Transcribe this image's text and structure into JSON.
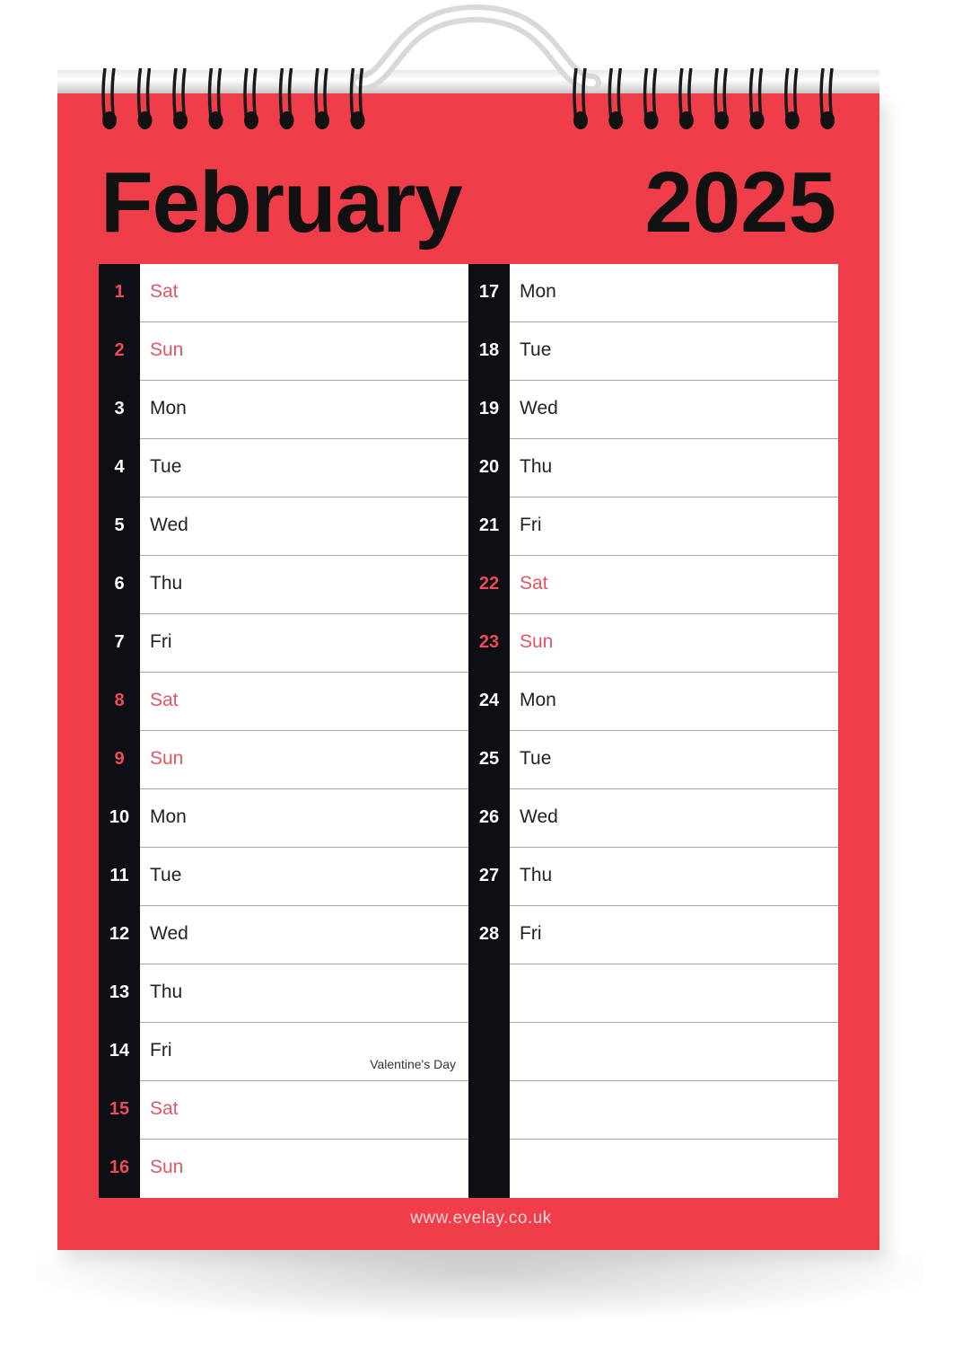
{
  "calendar": {
    "month": "February",
    "year": "2025",
    "website": "www.evelay.co.uk",
    "colors": {
      "page": "#ef3d4a",
      "strip": "#0d0f14",
      "weekend_text": "#e25662"
    },
    "left_column": [
      {
        "num": "1",
        "day": "Sat",
        "weekend": true,
        "note": ""
      },
      {
        "num": "2",
        "day": "Sun",
        "weekend": true,
        "note": ""
      },
      {
        "num": "3",
        "day": "Mon",
        "weekend": false,
        "note": ""
      },
      {
        "num": "4",
        "day": "Tue",
        "weekend": false,
        "note": ""
      },
      {
        "num": "5",
        "day": "Wed",
        "weekend": false,
        "note": ""
      },
      {
        "num": "6",
        "day": "Thu",
        "weekend": false,
        "note": ""
      },
      {
        "num": "7",
        "day": "Fri",
        "weekend": false,
        "note": ""
      },
      {
        "num": "8",
        "day": "Sat",
        "weekend": true,
        "note": ""
      },
      {
        "num": "9",
        "day": "Sun",
        "weekend": true,
        "note": ""
      },
      {
        "num": "10",
        "day": "Mon",
        "weekend": false,
        "note": ""
      },
      {
        "num": "11",
        "day": "Tue",
        "weekend": false,
        "note": ""
      },
      {
        "num": "12",
        "day": "Wed",
        "weekend": false,
        "note": ""
      },
      {
        "num": "13",
        "day": "Thu",
        "weekend": false,
        "note": ""
      },
      {
        "num": "14",
        "day": "Fri",
        "weekend": false,
        "note": "Valentine's Day"
      },
      {
        "num": "15",
        "day": "Sat",
        "weekend": true,
        "note": ""
      },
      {
        "num": "16",
        "day": "Sun",
        "weekend": true,
        "note": ""
      }
    ],
    "right_column": [
      {
        "num": "17",
        "day": "Mon",
        "weekend": false,
        "note": ""
      },
      {
        "num": "18",
        "day": "Tue",
        "weekend": false,
        "note": ""
      },
      {
        "num": "19",
        "day": "Wed",
        "weekend": false,
        "note": ""
      },
      {
        "num": "20",
        "day": "Thu",
        "weekend": false,
        "note": ""
      },
      {
        "num": "21",
        "day": "Fri",
        "weekend": false,
        "note": ""
      },
      {
        "num": "22",
        "day": "Sat",
        "weekend": true,
        "note": ""
      },
      {
        "num": "23",
        "day": "Sun",
        "weekend": true,
        "note": ""
      },
      {
        "num": "24",
        "day": "Mon",
        "weekend": false,
        "note": ""
      },
      {
        "num": "25",
        "day": "Tue",
        "weekend": false,
        "note": ""
      },
      {
        "num": "26",
        "day": "Wed",
        "weekend": false,
        "note": ""
      },
      {
        "num": "27",
        "day": "Thu",
        "weekend": false,
        "note": ""
      },
      {
        "num": "28",
        "day": "Fri",
        "weekend": false,
        "note": ""
      },
      {
        "num": "",
        "day": "",
        "weekend": false,
        "note": ""
      },
      {
        "num": "",
        "day": "",
        "weekend": false,
        "note": ""
      },
      {
        "num": "",
        "day": "",
        "weekend": false,
        "note": ""
      },
      {
        "num": "",
        "day": "",
        "weekend": false,
        "note": ""
      }
    ]
  }
}
